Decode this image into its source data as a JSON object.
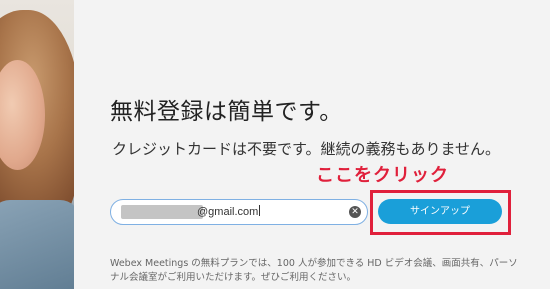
{
  "photo": {
    "description_icon": "person-photo"
  },
  "signup": {
    "heading": "無料登録は簡単です。",
    "subtext": "クレジットカードは不要です。継続の義務もありません。",
    "email_value": "@gmail.com",
    "clear_icon": "close-icon",
    "button_label": "サインアップ",
    "footer": "Webex Meetings の無料プランでは、100 人が参加できる HD ビデオ会議、画面共有、パーソナル会議室がご利用いただけます。ぜひご利用ください。"
  },
  "annotation": {
    "text": "ここをクリック",
    "color": "#e0203b"
  },
  "colors": {
    "accent": "#1a9fd9",
    "highlight": "#e0203b"
  }
}
